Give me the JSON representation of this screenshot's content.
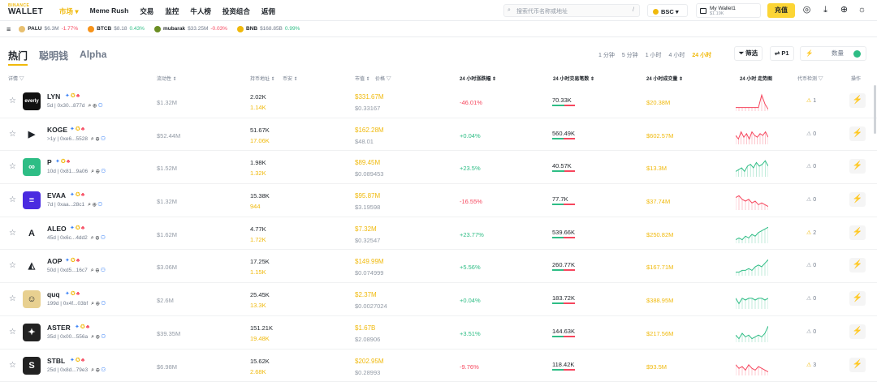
{
  "header": {
    "logo_top": "BINANCE",
    "logo_bottom": "WALLET",
    "nav": [
      {
        "label": "市场 ▾",
        "active": true
      },
      {
        "label": "Meme Rush"
      },
      {
        "label": "交易"
      },
      {
        "label": "监控"
      },
      {
        "label": "牛人榜"
      },
      {
        "label": "投资组合"
      },
      {
        "label": "返佣"
      }
    ],
    "search_placeholder": "搜索代币名称或地址",
    "search_shortcut": "/",
    "network": "BSC",
    "wallet_name": "My Wallet1",
    "wallet_balance": "$1.19K",
    "recharge": "充值"
  },
  "ticker": [
    {
      "name": "PALU",
      "vol": "$6.3M",
      "chg": "-1.77%",
      "dir": "r",
      "color": "#e8c070"
    },
    {
      "name": "BTCB",
      "vol": "$8.18",
      "chg": "0.43%",
      "dir": "g",
      "color": "#f7931a"
    },
    {
      "name": "mubarak",
      "vol": "$33.25M",
      "chg": "-0.03%",
      "dir": "r",
      "color": "#6b8e23"
    },
    {
      "name": "BNB",
      "vol": "$168.85B",
      "chg": "0.99%",
      "dir": "g",
      "color": "#f0b90b"
    }
  ],
  "tabs": [
    {
      "label": "热门",
      "active": true
    },
    {
      "label": "聪明钱"
    },
    {
      "label": "Alpha"
    }
  ],
  "timeframes": [
    {
      "label": "1 分钟"
    },
    {
      "label": "5 分钟"
    },
    {
      "label": "1 小时"
    },
    {
      "label": "4 小时"
    },
    {
      "label": "24 小时",
      "active": true
    }
  ],
  "filter_label": "筛选",
  "p1_label": "P1",
  "qty_label": "数量",
  "columns": {
    "detail": "详情 ▽",
    "liquidity": "流动性 ⇕",
    "holders": "持币地址 ⇕",
    "tokens": "币安 ⇕",
    "mcap": "市值 ⇕",
    "price": "价格 ▽",
    "chg": "24 小时涨跌幅 ⇕",
    "txns": "24 小时交易笔数 ⇕",
    "volume": "24 小时成交量 ⇕",
    "trend": "24 小时 走势图",
    "risk": "代币检测 ▽",
    "action": "操作"
  },
  "rows": [
    {
      "name": "LYN",
      "age": "5d",
      "addr": "0x30...877d",
      "liq": "$1.32M",
      "holders": "2.02K",
      "bh": "1.14K",
      "mcap": "$331.67M",
      "price": "$0.33167",
      "chg": "-46.01%",
      "dir": "r",
      "txns": "70.33K",
      "buy": 0.55,
      "vol": "$20.38M",
      "risk": "1",
      "riskwarn": true,
      "logo": "#111",
      "logotext": "everly",
      "spark": "r",
      "trend": [
        0.2,
        0.2,
        0.2,
        0.2,
        0.2,
        0.2,
        0.2,
        0.2,
        0.9,
        0.4,
        0.1
      ]
    },
    {
      "name": "KOGE",
      "age": ">1y",
      "addr": "0xe6...5528",
      "liq": "$52.44M",
      "holders": "51.67K",
      "bh": "17.06K",
      "mcap": "$162.28M",
      "price": "$48.01",
      "chg": "+0.04%",
      "dir": "g",
      "txns": "560.49K",
      "buy": 0.5,
      "vol": "$602.57M",
      "risk": "0",
      "riskwarn": false,
      "logo": "#fff",
      "logotext": "▶",
      "spark": "r",
      "trend": [
        0.5,
        0.3,
        0.7,
        0.4,
        0.6,
        0.3,
        0.7,
        0.5,
        0.4,
        0.6,
        0.5,
        0.7,
        0.4
      ]
    },
    {
      "name": "P",
      "age": "10d",
      "addr": "0x81...9a06",
      "liq": "$1.52M",
      "holders": "1.98K",
      "bh": "1.32K",
      "mcap": "$89.45M",
      "price": "$0.089453",
      "chg": "+23.5%",
      "dir": "g",
      "txns": "40.57K",
      "buy": 0.55,
      "vol": "$13.3M",
      "risk": "0",
      "riskwarn": false,
      "logo": "#2ebd85",
      "logotext": "∞",
      "spark": "g",
      "trend": [
        0.3,
        0.4,
        0.5,
        0.3,
        0.6,
        0.7,
        0.5,
        0.8,
        0.6,
        0.7,
        0.9,
        0.6
      ]
    },
    {
      "name": "EVAA",
      "age": "7d",
      "addr": "0xaa...28c1",
      "liq": "$1.32M",
      "holders": "15.38K",
      "bh": "944",
      "mcap": "$95.87M",
      "price": "$3.19598",
      "chg": "-16.55%",
      "dir": "r",
      "txns": "77.7K",
      "buy": 0.5,
      "vol": "$37.74M",
      "risk": "0",
      "riskwarn": false,
      "logo": "#4a2be0",
      "logotext": "≡",
      "spark": "r",
      "trend": [
        0.7,
        0.8,
        0.6,
        0.5,
        0.6,
        0.4,
        0.5,
        0.3,
        0.4,
        0.3,
        0.2
      ]
    },
    {
      "name": "ALEO",
      "age": "45d",
      "addr": "0x6c...4dd2",
      "liq": "$1.62M",
      "holders": "4.77K",
      "bh": "1.72K",
      "mcap": "$7.32M",
      "price": "$0.32547",
      "chg": "+23.77%",
      "dir": "g",
      "txns": "539.66K",
      "buy": 0.5,
      "vol": "$250.82M",
      "risk": "2",
      "riskwarn": true,
      "logo": "#fff",
      "logotext": "A",
      "spark": "g",
      "trend": [
        0.2,
        0.3,
        0.2,
        0.4,
        0.3,
        0.5,
        0.4,
        0.6,
        0.7,
        0.8,
        0.9
      ]
    },
    {
      "name": "AOP",
      "age": "50d",
      "addr": "0xd5...16c7",
      "liq": "$3.06M",
      "holders": "17.25K",
      "bh": "1.15K",
      "mcap": "$149.99M",
      "price": "$0.074999",
      "chg": "+5.56%",
      "dir": "g",
      "txns": "260.77K",
      "buy": 0.5,
      "vol": "$167.71M",
      "risk": "0",
      "riskwarn": false,
      "logo": "#fff",
      "logotext": "◭",
      "spark": "g",
      "trend": [
        0.2,
        0.2,
        0.3,
        0.3,
        0.4,
        0.3,
        0.5,
        0.6,
        0.5,
        0.7,
        0.9
      ]
    },
    {
      "name": "quq",
      "age": "199d",
      "addr": "0x4f...03bf",
      "liq": "$2.6M",
      "holders": "25.45K",
      "bh": "13.3K",
      "mcap": "$2.37M",
      "price": "$0.0027024",
      "chg": "+0.04%",
      "dir": "g",
      "txns": "183.72K",
      "buy": 0.5,
      "vol": "$388.95M",
      "risk": "0",
      "riskwarn": false,
      "logo": "#e8d090",
      "logotext": "☺",
      "spark": "g",
      "trend": [
        0.6,
        0.3,
        0.6,
        0.5,
        0.6,
        0.6,
        0.5,
        0.6,
        0.6,
        0.5,
        0.6
      ]
    },
    {
      "name": "ASTER",
      "age": "35d",
      "addr": "0x00...556a",
      "liq": "$39.35M",
      "holders": "151.21K",
      "bh": "19.48K",
      "mcap": "$1.67B",
      "price": "$2.08906",
      "chg": "+3.51%",
      "dir": "g",
      "txns": "144.63K",
      "buy": 0.5,
      "vol": "$217.56M",
      "risk": "0",
      "riskwarn": false,
      "logo": "#222",
      "logotext": "✦",
      "spark": "g",
      "trend": [
        0.4,
        0.2,
        0.5,
        0.3,
        0.4,
        0.2,
        0.3,
        0.4,
        0.3,
        0.5,
        0.9
      ]
    },
    {
      "name": "STBL",
      "age": "25d",
      "addr": "0x8d...79e3",
      "liq": "$6.98M",
      "holders": "15.62K",
      "bh": "2.68K",
      "mcap": "$202.95M",
      "price": "$0.28993",
      "chg": "-9.76%",
      "dir": "r",
      "txns": "118.42K",
      "buy": 0.5,
      "vol": "$93.5M",
      "risk": "3",
      "riskwarn": true,
      "logo": "#222",
      "logotext": "S",
      "spark": "r",
      "trend": [
        0.6,
        0.4,
        0.5,
        0.3,
        0.6,
        0.4,
        0.3,
        0.5,
        0.4,
        0.3,
        0.2
      ]
    }
  ]
}
